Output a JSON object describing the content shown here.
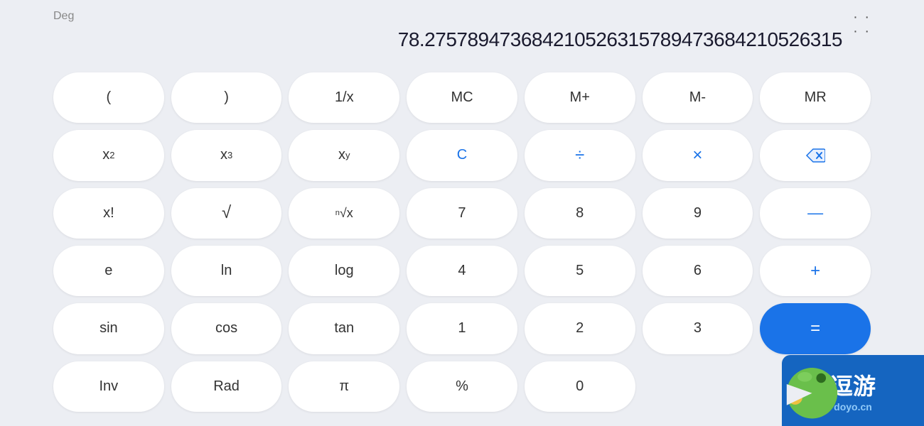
{
  "calculator": {
    "mode_label": "Deg",
    "display_value": "78.275789473684210526315789473684210526315",
    "more_options_icon": "⋮⋮",
    "buttons": [
      {
        "id": "open-paren",
        "label": "(",
        "type": "func"
      },
      {
        "id": "close-paren",
        "label": ")",
        "type": "func"
      },
      {
        "id": "reciprocal",
        "label": "1/x",
        "type": "func"
      },
      {
        "id": "mc",
        "label": "MC",
        "type": "func"
      },
      {
        "id": "mplus",
        "label": "M+",
        "type": "func"
      },
      {
        "id": "mminus",
        "label": "M-",
        "type": "func"
      },
      {
        "id": "mr",
        "label": "MR",
        "type": "func"
      },
      {
        "id": "x2",
        "label": "x²",
        "type": "func"
      },
      {
        "id": "x3",
        "label": "x³",
        "type": "func"
      },
      {
        "id": "xy",
        "label": "xʸ",
        "type": "func"
      },
      {
        "id": "clear",
        "label": "C",
        "type": "blue"
      },
      {
        "id": "divide",
        "label": "÷",
        "type": "operator"
      },
      {
        "id": "multiply",
        "label": "×",
        "type": "operator"
      },
      {
        "id": "backspace",
        "label": "⌫",
        "type": "backspace"
      },
      {
        "id": "factorial",
        "label": "x!",
        "type": "func"
      },
      {
        "id": "sqrt",
        "label": "√",
        "type": "func"
      },
      {
        "id": "nth-root",
        "label": "ⁿ√x",
        "type": "func"
      },
      {
        "id": "7",
        "label": "7",
        "type": "num"
      },
      {
        "id": "8",
        "label": "8",
        "type": "num"
      },
      {
        "id": "9",
        "label": "9",
        "type": "num"
      },
      {
        "id": "minus",
        "label": "—",
        "type": "operator"
      },
      {
        "id": "e",
        "label": "e",
        "type": "func"
      },
      {
        "id": "ln",
        "label": "ln",
        "type": "func"
      },
      {
        "id": "log",
        "label": "log",
        "type": "func"
      },
      {
        "id": "4",
        "label": "4",
        "type": "num"
      },
      {
        "id": "5",
        "label": "5",
        "type": "num"
      },
      {
        "id": "6",
        "label": "6",
        "type": "num"
      },
      {
        "id": "plus",
        "label": "+",
        "type": "operator"
      },
      {
        "id": "sin",
        "label": "sin",
        "type": "func"
      },
      {
        "id": "cos",
        "label": "cos",
        "type": "func"
      },
      {
        "id": "tan",
        "label": "tan",
        "type": "func"
      },
      {
        "id": "1",
        "label": "1",
        "type": "num"
      },
      {
        "id": "2",
        "label": "2",
        "type": "num"
      },
      {
        "id": "3",
        "label": "3",
        "type": "num"
      },
      {
        "id": "equals",
        "label": "=",
        "type": "equals"
      },
      {
        "id": "inv",
        "label": "Inv",
        "type": "func"
      },
      {
        "id": "rad",
        "label": "Rad",
        "type": "func"
      },
      {
        "id": "pi",
        "label": "π",
        "type": "func"
      },
      {
        "id": "percent",
        "label": "%",
        "type": "func"
      },
      {
        "id": "0",
        "label": "0",
        "type": "num"
      },
      {
        "id": "dot",
        "label": ".",
        "type": "num"
      },
      {
        "id": "equals2",
        "label": "=",
        "type": "equals"
      }
    ]
  },
  "watermark": {
    "text": "逗游",
    "url": "doyo.cn"
  }
}
